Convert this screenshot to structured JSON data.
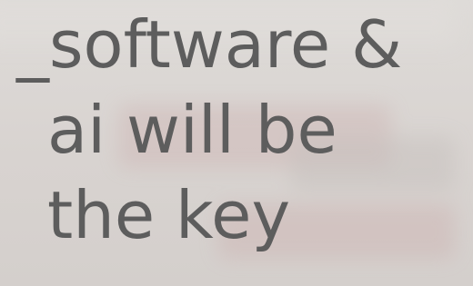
{
  "headline": {
    "line1": "_software &",
    "line2": "ai will be",
    "line3": "the key"
  }
}
